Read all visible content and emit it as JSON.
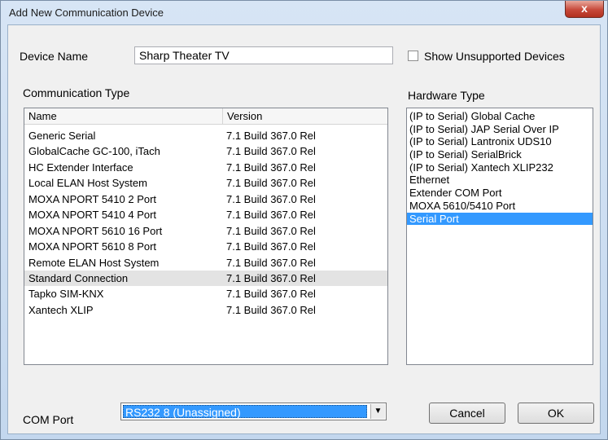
{
  "window": {
    "title": "Add New Communication Device",
    "close_glyph": "x"
  },
  "device": {
    "label": "Device Name",
    "value": "Sharp Theater TV",
    "show_unsupported_label": "Show Unsupported Devices",
    "show_unsupported_checked": false
  },
  "comm": {
    "label": "Communication Type",
    "columns": [
      "Name",
      "Version"
    ],
    "rows": [
      {
        "name": "Generic Serial",
        "version": "7.1 Build 367.0 Rel"
      },
      {
        "name": "GlobalCache GC-100, iTach",
        "version": "7.1 Build 367.0 Rel"
      },
      {
        "name": "HC Extender Interface",
        "version": "7.1 Build 367.0 Rel"
      },
      {
        "name": "Local ELAN Host System",
        "version": "7.1 Build 367.0 Rel"
      },
      {
        "name": "MOXA NPORT 5410 2 Port",
        "version": "7.1 Build 367.0 Rel"
      },
      {
        "name": "MOXA NPORT 5410 4 Port",
        "version": "7.1 Build 367.0 Rel"
      },
      {
        "name": "MOXA NPORT 5610 16 Port",
        "version": "7.1 Build 367.0 Rel"
      },
      {
        "name": "MOXA NPORT 5610 8 Port",
        "version": "7.1 Build 367.0 Rel"
      },
      {
        "name": "Remote ELAN Host System",
        "version": "7.1 Build 367.0 Rel"
      },
      {
        "name": "Standard Connection",
        "version": "7.1 Build 367.0 Rel"
      },
      {
        "name": "Tapko SIM-KNX",
        "version": "7.1 Build 367.0 Rel"
      },
      {
        "name": "Xantech XLIP",
        "version": "7.1 Build 367.0 Rel"
      }
    ],
    "selected_index": 9
  },
  "hardware": {
    "label": "Hardware Type",
    "items": [
      "(IP to Serial) Global Cache",
      "(IP to Serial) JAP Serial Over IP",
      "(IP to Serial) Lantronix UDS10",
      "(IP to Serial) SerialBrick",
      "(IP to Serial) Xantech XLIP232",
      "Ethernet",
      "Extender COM Port",
      "MOXA 5610/5410 Port",
      "Serial Port"
    ],
    "selected_index": 8
  },
  "com_port": {
    "label": "COM Port",
    "selected": "RS232 8 (Unassigned)",
    "arrow_icon": "chevron-down-icon"
  },
  "buttons": {
    "cancel": "Cancel",
    "ok": "OK"
  },
  "colors": {
    "selection": "#3399ff",
    "row_highlight": "#e3e3e3",
    "dialog_bg": "#f0f0f0",
    "close_red": "#c7493a"
  }
}
